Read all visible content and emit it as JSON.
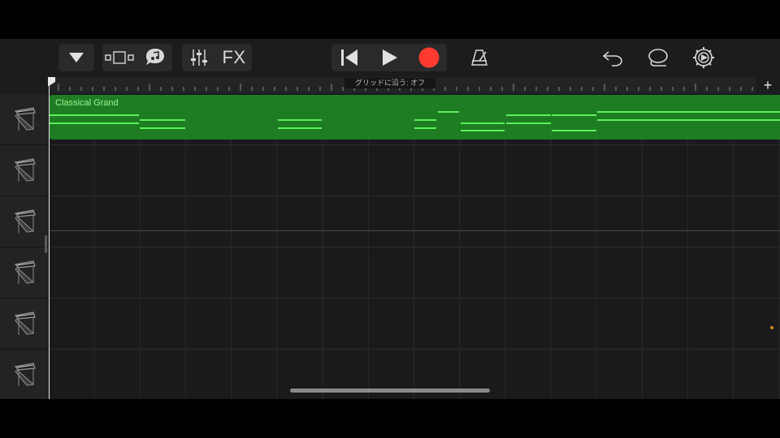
{
  "toolbar": {
    "fx_label": "FX",
    "icons": [
      "dropdown-triangle-icon",
      "view-toggle-icon",
      "loop-browser-icon",
      "mixer-sliders-icon",
      "rewind-icon",
      "play-icon",
      "record-icon",
      "metronome-icon",
      "undo-icon",
      "lasso-icon",
      "settings-gear-icon"
    ],
    "record_color": "#ff3b30"
  },
  "ruler": {
    "snap_label": "グリッドに沿う: オフ",
    "add_label": "+"
  },
  "region": {
    "name": "Classical Grand",
    "color": "#1e7d23",
    "note_color": "#5cf05a"
  },
  "tracks": [
    {
      "instrument_icon": "grand-piano-icon"
    },
    {
      "instrument_icon": "grand-piano-icon"
    },
    {
      "instrument_icon": "grand-piano-icon"
    },
    {
      "instrument_icon": "grand-piano-icon"
    },
    {
      "instrument_icon": "grand-piano-icon"
    },
    {
      "instrument_icon": "grand-piano-icon"
    }
  ]
}
